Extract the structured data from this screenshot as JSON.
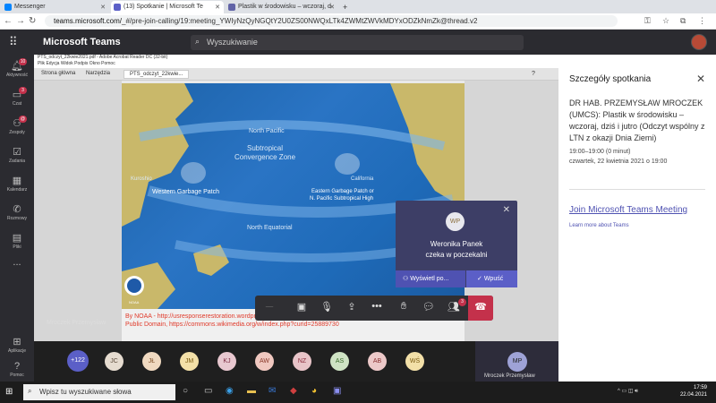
{
  "browser": {
    "tabs": [
      {
        "label": "Messenger",
        "color": "#0084ff"
      },
      {
        "label": "(13) Spotkanie | Microsoft Te",
        "color": "#5b5fc7"
      },
      {
        "label": "Plastik w środowisku – wczoraj, d",
        "color": "#6264a7"
      }
    ],
    "url_prefix": "teams.microsoft.com/",
    "url_rest": "_#/pre-join-calling/19:meeting_YWIyNzQyNGQtY2U0ZS00NWQxLTk4ZWMtZWVkMDYxODZkNmZk@thread.v2"
  },
  "teams": {
    "title": "Microsoft Teams",
    "search_placeholder": "Wyszukiwanie"
  },
  "rail": [
    {
      "label": "Aktywność",
      "badge": "10",
      "icon": "bell-icon"
    },
    {
      "label": "Czat",
      "badge": "3",
      "icon": "chat-icon"
    },
    {
      "label": "Zespoły",
      "badge": "@",
      "icon": "teams-icon"
    },
    {
      "label": "Zadania",
      "badge": "",
      "icon": "tasks-icon"
    },
    {
      "label": "Kalendarz",
      "badge": "",
      "icon": "calendar-icon"
    },
    {
      "label": "Rozmowy",
      "badge": "",
      "icon": "phone-icon"
    },
    {
      "label": "Pliki",
      "badge": "",
      "icon": "files-icon"
    }
  ],
  "rail_more": "...",
  "rail_bottom": [
    {
      "label": "Aplikacje",
      "icon": "apps-store-icon"
    },
    {
      "label": "Pomoc",
      "icon": "help-icon"
    }
  ],
  "acrobat": {
    "title": "PTS_odczyt_22kwie2021.pdf - Adobe Acrobat Reader DC (32-bit)",
    "menu": "Plik  Edycja  Widok  Podpis  Okno  Pomoc",
    "tabs": [
      "Strona główna",
      "Narzędzia",
      "PTS_odczyt_22kwie..."
    ]
  },
  "map": {
    "labels": {
      "north_pacific": "North Pacific",
      "subtropical": "Subtropical",
      "convergence": "Convergence Zone",
      "kuroshio": "Kuroshio",
      "western": "Western Garbage Patch",
      "california": "California",
      "eastern1": "Eastern Garbage Patch or",
      "eastern2": "N. Pacific Subtropical High",
      "north_equatorial": "North Equatorial",
      "noaa": "NOAA",
      "credit": "www.MarineDebris.noaa.gov"
    },
    "caption": "By NOAA - http://usresponserestoration.wordpress.com/2013/03/07/the-great-pacific-garbage-patch-science-vs-myth/, Public Domain, https://commons.wikimedia.org/w/index.php?curid=25889730"
  },
  "presenter_name": "Mroczek Przemysław",
  "popup": {
    "avatar": "WP",
    "name": "Weronika Panek",
    "message": "czeka w poczekalni",
    "view_label": "Wyświetl po...",
    "admit_label": "Wpuść"
  },
  "controls": {
    "people_badge": "3"
  },
  "details": {
    "title": "Szczegóły spotkania",
    "meeting_title": "DR HAB. PRZEMYSŁAW MROCZEK (UMCS): Plastik w środowisku – wczoraj, dziś i jutro (Odczyt wspólny z LTN z okazji Dnia Ziemi)",
    "time": "19:00–19:00 (0 minut)",
    "date": "czwartek, 22 kwietnia 2021 o 19:00",
    "join": "Join Microsoft Teams Meeting",
    "learn": "Learn more about Teams"
  },
  "participants": [
    {
      "initials": "+122",
      "bg": "#5b5fc7",
      "fg": "#ffffff"
    },
    {
      "initials": "JC",
      "bg": "#e6dcd0",
      "fg": "#5a4a3a"
    },
    {
      "initials": "JŁ",
      "bg": "#f0d9c0",
      "fg": "#7a4a20"
    },
    {
      "initials": "JM",
      "bg": "#f3e0a8",
      "fg": "#7a5a10"
    },
    {
      "initials": "KJ",
      "bg": "#e8c8d0",
      "fg": "#7a2a40"
    },
    {
      "initials": "AW",
      "bg": "#f0c8c0",
      "fg": "#8a3a2a"
    },
    {
      "initials": "NZ",
      "bg": "#e8c4c8",
      "fg": "#8a2a3a"
    },
    {
      "initials": "AS",
      "bg": "#cfe3c4",
      "fg": "#3a6a2a"
    },
    {
      "initials": "AB",
      "bg": "#ecc8c8",
      "fg": "#8a3030"
    },
    {
      "initials": "WŚ",
      "bg": "#f3e0a8",
      "fg": "#7a5a10"
    }
  ],
  "self": {
    "initials": "MP",
    "name": "Mroczek Przemysław"
  },
  "taskbar": {
    "search_placeholder": "Wpisz tu wyszukiwane słowa",
    "time": "17:59",
    "date": "22.04.2021"
  }
}
